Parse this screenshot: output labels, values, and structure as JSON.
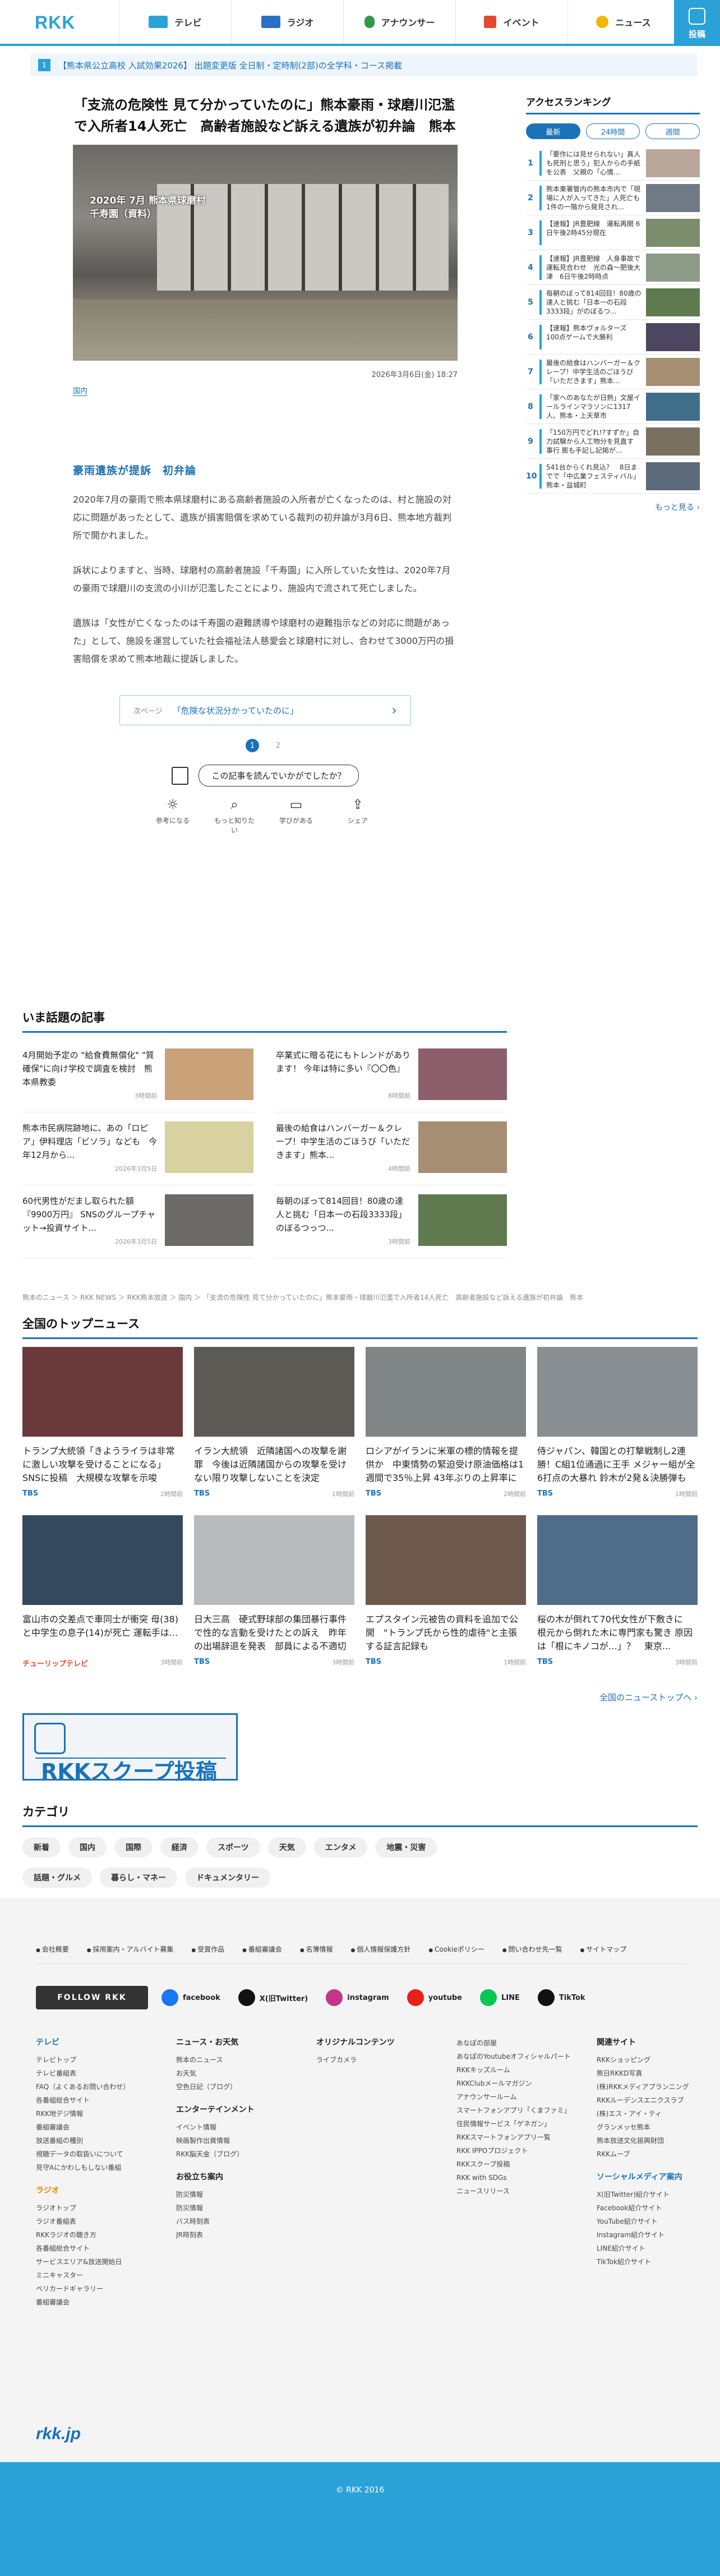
{
  "header": {
    "logo": "RKK",
    "nav": [
      {
        "label": "テレビ",
        "icon": "tv-icon",
        "color": "#2aa2d8"
      },
      {
        "label": "ラジオ",
        "icon": "radio-icon",
        "color": "#2a6fc4"
      },
      {
        "label": "アナウンサー",
        "icon": "announcer-icon",
        "color": "#2e9a4a"
      },
      {
        "label": "イベント",
        "icon": "event-icon",
        "color": "#e34a2f"
      },
      {
        "label": "ニュース",
        "icon": "news-icon",
        "color": "#f2b600"
      }
    ],
    "post_label": "投稿"
  },
  "ticker": {
    "num": "1",
    "text": "【熊本県公立高校 入試効果2026】 出題変更版  全日制・定時制(2部)の全学科・コース掲載"
  },
  "article": {
    "headline": "「支流の危険性 見て分かっていたのに」熊本豪雨・球磨川氾濫で入所者14人死亡　高齢者施設など訴える遺族が初弁論　熊本",
    "photo_caption_line1": "2020年 7月 熊本県球磨村",
    "photo_caption_line2": "千寿園（資料）",
    "date": "2026年3月6日(金) 18:27",
    "category": "国内",
    "subheading": "豪雨遺族が提訴　初弁論",
    "paragraphs": [
      "2020年7月の豪雨で熊本県球磨村にある高齢者施設の入所者が亡くなったのは、村と施設の対応に問題があったとして、遺族が損害賠償を求めている裁判の初弁論が3月6日、熊本地方裁判所で開かれました。",
      "訴状によりますと、当時、球磨村の高齢者施設「千寿園」に入所していた女性は、2020年7月の豪雨で球磨川の支流の小川が氾濫したことにより、施設内で流されて死亡しました。",
      "遺族は「女性が亡くなったのは千寿園の避難誘導や球磨村の避難指示などの対応に問題があった」として、施設を運営していた社会福祉法人慈愛会と球磨村に対し、合わせて3000万円の損害賠償を求めて熊本地裁に提訴しました。"
    ],
    "next_label": "次ページ",
    "next_title": "「危険な状況分かっていたのに」",
    "pages": [
      "1",
      "2"
    ],
    "feedback_question": "この記事を読んでいかがでしたか？",
    "feedback_buttons": [
      {
        "label": "参考になる",
        "glyph": "☼"
      },
      {
        "label": "もっと知りたい",
        "glyph": "⌕"
      },
      {
        "label": "学びがある",
        "glyph": "▭"
      },
      {
        "label": "シェア",
        "glyph": "⇪"
      }
    ]
  },
  "sidebar": {
    "title": "アクセスランキング",
    "tabs": [
      "最新",
      "24時間",
      "週間"
    ],
    "items": [
      {
        "n": "1",
        "text": "「要作には見せられない」真人も死刑と思う」犯人からの手紙を公表　父親の「心情..."
      },
      {
        "n": "2",
        "text": "熊本東署管内の熊本市内で「現場に人が入ってきた」人死亡も1件の一階から発見され..."
      },
      {
        "n": "3",
        "text": "【速報】JR豊肥線　運転再開 6日午後2時45分現在"
      },
      {
        "n": "4",
        "text": "【速報】JR豊肥線　人身事故で運転見合わせ　光の森～肥後大津　6日午後2時時点"
      },
      {
        "n": "5",
        "text": "毎朝のぼって814回目！80歳の達人と挑む「日本一の石段3333段」がのぼるつ..."
      },
      {
        "n": "6",
        "text": "【速報】熊本ヴォルターズ 100点ゲームで大勝利"
      },
      {
        "n": "7",
        "text": "最後の給食はハンバーガー＆クレープ！中学生活のごほうび「いただきます」熊本..."
      },
      {
        "n": "8",
        "text": "「家へのあなたが日熟」文屋イールラインマラソンに1317人、熊本・上天草市"
      },
      {
        "n": "9",
        "text": "「150万円でどれ!?すずか」自力試験から人工物分を見直す　事行 膨も手記し記掲が..."
      },
      {
        "n": "10",
        "text": "541台からくれ見込？　8日までで「中広業フェスティバル」熊本・益城町"
      }
    ],
    "more": "もっと見る ›"
  },
  "watched": {
    "title": "いま話題の記事",
    "items": [
      {
        "text": "4月開始予定の \"給食費無償化\" \"質確保\"に向け学校で調査を検討　熊本県教委",
        "time": "3時間前"
      },
      {
        "text": "卒業式に贈る花にもトレンドがあります！ 今年は特に多い『〇〇色』",
        "time": "8時間前"
      },
      {
        "text": "熊本市民病院跡地に、あの「ロピア」伊料理店「ビソラ」なども　今年12月から...",
        "time": "2026年3月5日"
      },
      {
        "text": "最後の給食はハンバーガー＆クレープ！中学生活のごほうび「いただきます」熊本...",
        "time": "4時間前"
      },
      {
        "text": "60代男性がだまし取られた額『9900万円』 SNSのグループチャット→投資サイト...",
        "time": "2026年3月5日"
      },
      {
        "text": "毎朝のぼって814回目！80歳の達人と挑む「日本一の石段3333段」のぼるつっつ...",
        "time": "3時間前"
      }
    ]
  },
  "breadcrumb": "熊本のニュース ＞ RKK NEWS ＞ RKK熊本放送 ＞ 国内 ＞ 「支流の危険性 見て分かっていたのに」熊本豪雨・球磨川氾濫で入所者14人死亡　高齢者施設など訴える遺族が初弁論　熊本",
  "top_news": {
    "title": "全国のトップニュース",
    "items": [
      {
        "text": "トランプ大統領「きようライラは非常に激しい攻撃を受けることになる」SNSに投稿　大規模な攻撃を示唆",
        "src": "TBS",
        "time": "2時間前"
      },
      {
        "text": "イラン大統領　近隣諸国への攻撃を謝罪　今後は近隣諸国からの攻撃を受けない限り攻撃しないことを決定",
        "src": "TBS",
        "time": "1時間前"
      },
      {
        "text": "ロシアがイランに米軍の標的情報を提供か　中東情勢の緊迫受け原油価格は1週間で35％上昇 43年ぶりの上昇率に",
        "src": "TBS",
        "time": "2時間前"
      },
      {
        "text": "侍ジャパン、韓国との打撃戦制し2連勝！C組1位通過に王手 メジャー組が全6打点の大暴れ 鈴木が2発＆決勝弾も",
        "src": "TBS",
        "time": "1時間前"
      },
      {
        "text": "富山市の交差点で車同士が衝突 母(38)と中学生の息子(14)が死亡 運転手は...",
        "src": "チューリップテレビ",
        "time": "3時間前"
      },
      {
        "text": "日大三高　硬式野球部の集団暴行事件で性的な言動を受けたとの訴え　昨年の出場辞退を発表　部員による不適切動画の拡散を受け",
        "src": "TBS",
        "time": "3時間前"
      },
      {
        "text": "エプスタイン元被告の資料を追加で公開　\"トランプ氏から性的虐待\"と主張する証言記録も",
        "src": "TBS",
        "time": "1時間前"
      },
      {
        "text": "桜の木が倒れて70代女性が下敷きに　根元から倒れた木に専門家も驚き 原因は「根にキノコが…」？　東京...",
        "src": "TBS",
        "time": "3時間前"
      }
    ],
    "more": "全国のニューストップへ ›"
  },
  "banner": {
    "text": "RKKスクープ投稿"
  },
  "categories": {
    "title": "カテゴリ",
    "items": [
      "新着",
      "国内",
      "国際",
      "経済",
      "スポーツ",
      "天気",
      "エンタメ",
      "地震・災害",
      "話題・グルメ",
      "暮らし・マネー",
      "ドキュメンタリー"
    ]
  },
  "footer": {
    "links": [
      "会社概要",
      "採用案内・アルバイト募集",
      "受賞作品",
      "番組審議会",
      "名簿情報",
      "個人情報保護方針",
      "Cookieポリシー",
      "問い合わせ先一覧",
      "サイトマップ"
    ],
    "follow": "FOLLOW RKK",
    "sns": [
      {
        "label": "facebook",
        "color": "#1877f2"
      },
      {
        "label": "X(旧Twitter)",
        "color": "#111111"
      },
      {
        "label": "instagram",
        "color": "#c1358a"
      },
      {
        "label": "youtube",
        "color": "#e62117"
      },
      {
        "label": "LINE",
        "color": "#06c755"
      },
      {
        "label": "TikTok",
        "color": "#111111"
      }
    ],
    "cols": [
      [
        {
          "title": "テレビ",
          "cls": "",
          "items": [
            "テレビトップ",
            "テレビ番組表",
            "FAQ（よくあるお問い合わせ）",
            "各番組総合サイト",
            "RKK地デジ情報",
            "番組審議会",
            "放送番組の種別",
            "視聴データの取扱いについて",
            "見守Aにかわしもしない番組"
          ]
        },
        {
          "title": "ラジオ",
          "cls": "or",
          "items": [
            "ラジオトップ",
            "ラジオ番組表",
            "RKKラジオの聴き方",
            "各番組総合サイト",
            "サービスエリア&放送開始日",
            "ミニキャスター",
            "ベリカードギャラリー",
            "番組審議会"
          ]
        }
      ],
      [
        {
          "title": "ニュース・お天気",
          "cls": "bk",
          "items": [
            "熊本のニュース",
            "お天気",
            "空色日記（ブログ）"
          ]
        },
        {
          "title": "エンターテインメント",
          "cls": "bk",
          "items": [
            "イベント情報",
            "映画製作出資情報",
            "RKK脳天金（ブログ）"
          ]
        },
        {
          "title": "お役立ち案内",
          "cls": "bk",
          "items": [
            "防災情報",
            "防災情報",
            "バス時刻表",
            "JR時刻表"
          ]
        }
      ],
      [
        {
          "title": "オリジナルコンテンツ",
          "cls": "bk",
          "items": [
            "ライブカメラ"
          ]
        }
      ],
      [
        {
          "title": "",
          "cls": "",
          "items": [
            "あなぽの部屋",
            "あなぽのYoutubeオフィシャルパートナーのRKK",
            "RKKキッズルーム",
            "RKKClubメールマガジン",
            "アナウンサールーム",
            "スマートフォンアプリ「くまファミ」",
            "住民情報サービス「ゲネガン」",
            "RKKスマートフォンアプリ一覧",
            "RKK IPPOプロジェクト",
            "RKKスクープ投稿",
            "RKK with SDGs",
            "ニュースリリース"
          ]
        }
      ],
      [
        {
          "title": "関連サイト",
          "cls": "bk",
          "items": [
            "RKKショッピング",
            "熊日RKKD写真",
            "(株)RKKメディアプランニング",
            "RKKルーデンスエニクスラブ",
            "(株)エス・アイ・ティ",
            "グランメッセ熊本",
            "熊本放送文化振興財団",
            "RKKムーブ"
          ]
        },
        {
          "title": "ソーシャルメディア案内",
          "cls": "",
          "items": [
            "X(旧Twitter)紹介サイト",
            "Facebook紹介サイト",
            "YouTube紹介サイト",
            "Instagram紹介サイト",
            "LINE紹介サイト",
            "TikTok紹介サイト"
          ]
        }
      ]
    ],
    "logo": "rkk.jp"
  },
  "copyright": "© RKK 2016"
}
